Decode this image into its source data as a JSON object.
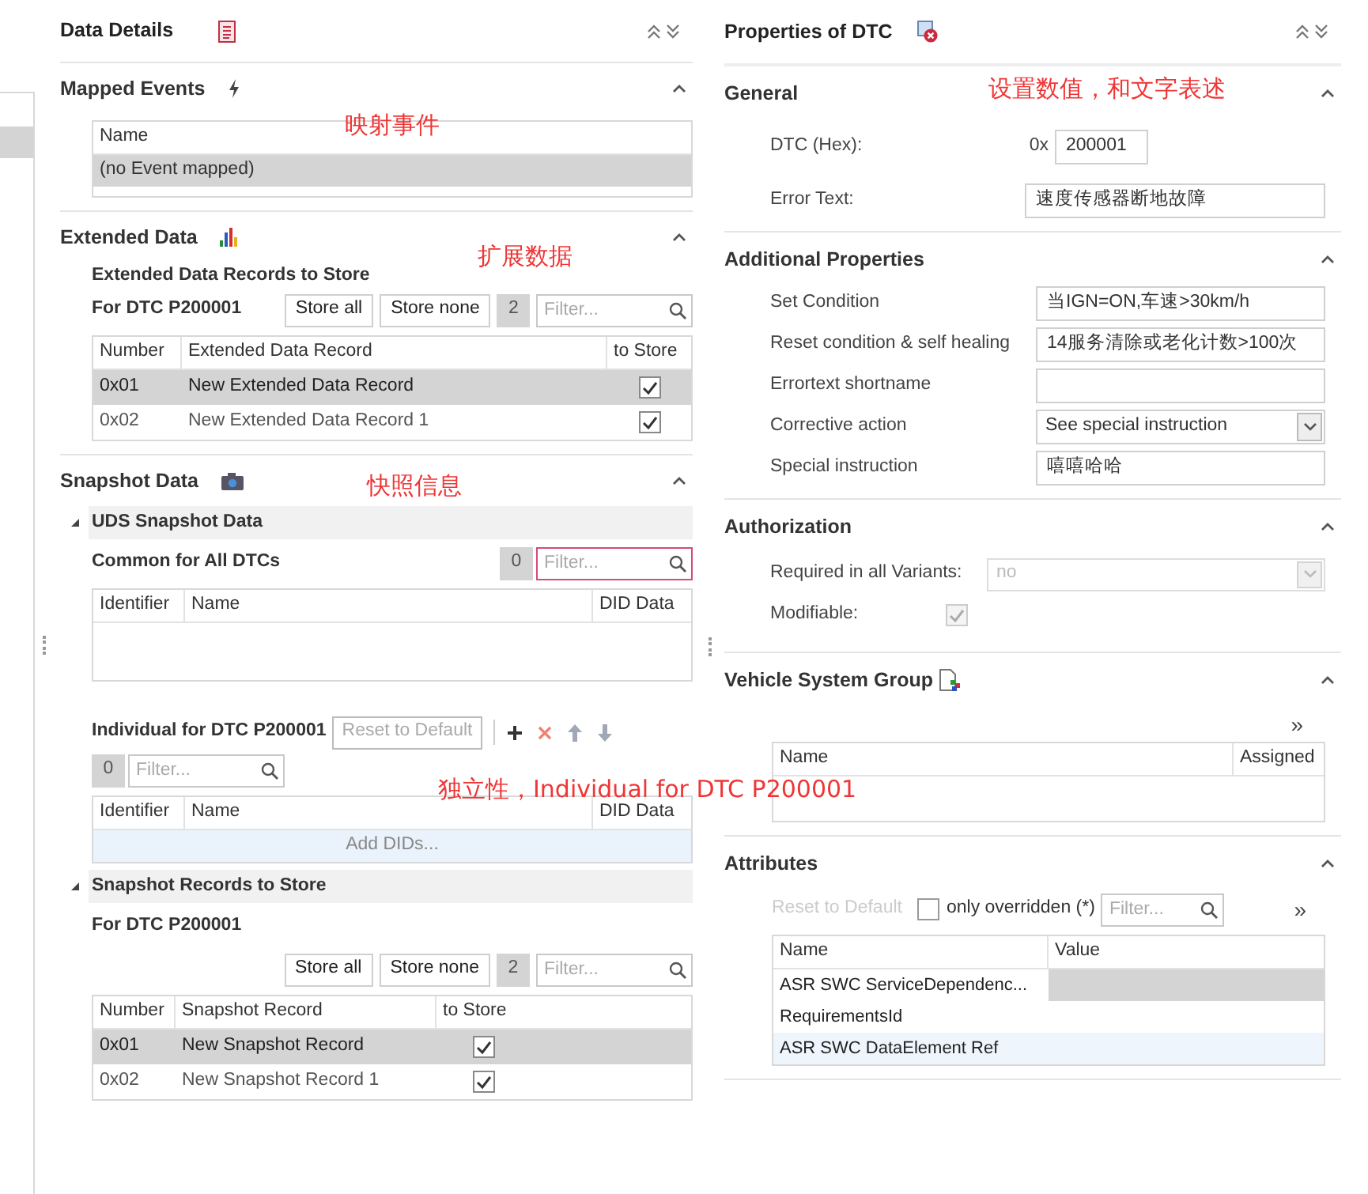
{
  "left": {
    "title": "Data Details",
    "mapped_events": {
      "title": "Mapped Events",
      "columns": [
        "Name"
      ],
      "rows": [
        {
          "cells": [
            "(no Event mapped)"
          ],
          "selected": true
        }
      ]
    },
    "extended_data": {
      "title": "Extended Data",
      "subtitle": "Extended Data Records to Store",
      "dtc_label": "For DTC P200001",
      "buttons": [
        "Store all",
        "Store none"
      ],
      "count": "2",
      "filter_placeholder": "Filter...",
      "columns": [
        "Number",
        "Extended Data Record",
        "to Store"
      ],
      "rows": [
        {
          "number": "0x01",
          "name": "New Extended Data Record",
          "checked": true,
          "selected": true
        },
        {
          "number": "0x02",
          "name": "New Extended Data Record 1",
          "checked": true,
          "selected": false
        }
      ]
    },
    "snapshot_data": {
      "title": "Snapshot Data",
      "uds": {
        "title": "UDS Snapshot Data",
        "expanded": true,
        "common": {
          "label": "Common for All DTCs",
          "count": "0",
          "filter_placeholder": "Filter...",
          "columns": [
            "Identifier",
            "Name",
            "DID Data"
          ]
        },
        "individual": {
          "label": "Individual for DTC P200001",
          "reset": "Reset to Default",
          "count": "0",
          "filter_placeholder": "Filter...",
          "columns": [
            "Identifier",
            "Name",
            "DID Data"
          ],
          "add_row": "Add DIDs..."
        }
      },
      "records": {
        "title": "Snapshot Records to Store",
        "expanded": true,
        "dtc_label": "For DTC P200001",
        "buttons": [
          "Store all",
          "Store none"
        ],
        "count": "2",
        "filter_placeholder": "Filter...",
        "columns": [
          "Number",
          "Snapshot Record",
          "to Store"
        ],
        "rows": [
          {
            "number": "0x01",
            "name": "New Snapshot Record",
            "checked": true,
            "selected": true
          },
          {
            "number": "0x02",
            "name": "New Snapshot Record 1",
            "checked": true,
            "selected": false
          }
        ]
      }
    }
  },
  "right": {
    "title": "Properties of DTC",
    "general": {
      "title": "General",
      "dtc_label": "DTC (Hex):",
      "prefix": "0x",
      "dtc_value": "200001",
      "error_label": "Error Text:",
      "error_value": "速度传感器断地故障"
    },
    "additional": {
      "title": "Additional Properties",
      "fields": [
        {
          "label": "Set Condition",
          "value": "当IGN=ON,车速>30km/h",
          "kind": "text"
        },
        {
          "label": "Reset condition & self healing",
          "value": "14服务清除或老化计数>100次",
          "kind": "text"
        },
        {
          "label": "Errortext shortname",
          "kind": "text"
        },
        {
          "label": "Corrective action",
          "value": "See special instruction",
          "kind": "select"
        },
        {
          "label": "Special instruction",
          "value": "嘻嘻哈哈",
          "kind": "text"
        }
      ]
    },
    "authorization": {
      "title": "Authorization",
      "required_label": "Required in all Variants:",
      "required_value": "no",
      "required_disabled": true,
      "modifiable_label": "Modifiable:",
      "modifiable_checked": true
    },
    "vehicle_system_group": {
      "title": "Vehicle System Group",
      "more": "»",
      "columns": [
        "Name",
        "Assigned"
      ]
    },
    "attributes": {
      "title": "Attributes",
      "reset": "Reset to Default",
      "only_overridden_label": "only overridden (*)",
      "only_overridden_checked": false,
      "filter_placeholder": "Filter...",
      "more": "»",
      "columns": [
        "Name",
        "Value"
      ],
      "rows": [
        {
          "name": "ASR SWC ServiceDependenc...",
          "selected": true,
          "hovered": false
        },
        {
          "name": "RequirementsId",
          "selected": false,
          "hovered": false
        },
        {
          "name": "ASR SWC DataElement Ref",
          "selected": false,
          "hovered": true
        }
      ]
    }
  },
  "annotations": [
    "映射事件",
    "扩展数据",
    "快照信息",
    "独立性，Individual for DTC P200001",
    "设置数值，和文字表述"
  ]
}
